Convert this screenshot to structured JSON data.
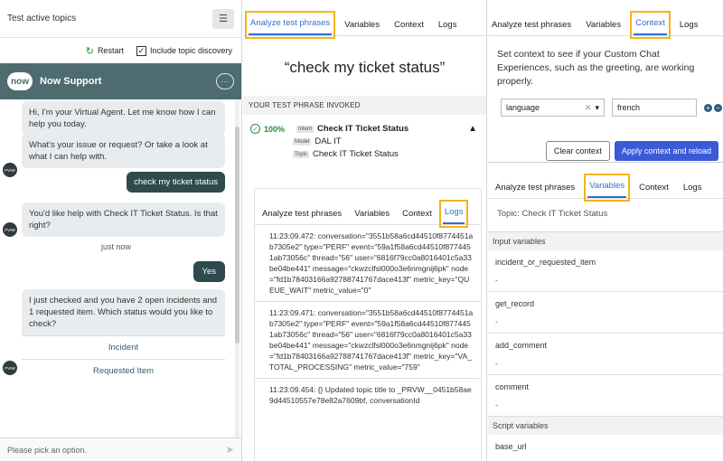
{
  "chat": {
    "panel_title": "Test active topics",
    "restart_label": "Restart",
    "include_discovery_label": "Include topic discovery",
    "header_name": "Now Support",
    "logo_text": "now",
    "avatar_text": "PVIW",
    "messages": {
      "bot1": "Hi, I'm your Virtual Agent. Let me know how I can help you today.",
      "bot2": "What's your issue or request? Or take a look at what I can help with.",
      "user1": "check my ticket status",
      "bot3": "You'd like help with Check IT Ticket Status. Is that right?",
      "timestamp": "just now",
      "user2": "Yes",
      "bot4": "I just checked and you have 2 open incidents and 1 requested item.  Which status would you like to check?",
      "option1": "Incident",
      "option2": "Requested Item"
    },
    "input_placeholder": "Please pick an option."
  },
  "analyze": {
    "tabs": [
      "Analyze test phrases",
      "Variables",
      "Context",
      "Logs"
    ],
    "phrase": "“check my ticket status”",
    "section_label": "YOUR TEST PHRASE INVOKED",
    "result": {
      "percent": "100%",
      "intent_tag": "Intent",
      "intent": "Check IT Ticket Status",
      "model_tag": "Model",
      "model": "DAL IT",
      "topic_tag": "Topic",
      "topic": "Check IT Ticket Status"
    },
    "logs_tabs": [
      "Analyze test phrases",
      "Variables",
      "Context",
      "Logs"
    ],
    "logs": [
      "11:23:09.472: conversation=\"3551b58a6cd44510f8774451ab7305e2\" type=\"PERF\" event=\"59a1f58a6cd44510f8774451ab73056c\" thread=\"56\" user=\"6816f79cc0a8016401c5a33be04be441\" message=\"ckwzclfsl000o3e6nmgnij6pk\" node=\"fd1b78403166a92788741767dace413f\" metric_key=\"QUEUE_WAIT\" metric_value=\"0\"",
      "11:23:09.471: conversation=\"3551b58a6cd44510f8774451ab7305e2\" type=\"PERF\" event=\"59a1f58a6cd44510f8774451ab73056c\" thread=\"56\" user=\"6816f79cc0a8016401c5a33be04be441\" message=\"ckwzclfsl000o3e6nmgnij6pk\" node=\"fd1b78403166a92788741767dace413f\" metric_key=\"VA_TOTAL_PROCESSING\" metric_value=\"759\"",
      "11:23:09.454: {} Updated topic title to _PRVW__0451b58ae9d44510557e78e82a7609bf, conversationId"
    ]
  },
  "context": {
    "tabs": [
      "Analyze test phrases",
      "Variables",
      "Context",
      "Logs"
    ],
    "description": "Set context to see if your Custom Chat Experiences, such as the greeting, are working properly.",
    "select_value": "language",
    "text_value": "french",
    "clear_label": "Clear context",
    "apply_label": "Apply context and reload"
  },
  "variables": {
    "tabs": [
      "Analyze test phrases",
      "Variables",
      "Context",
      "Logs"
    ],
    "topic_line": "Topic:  Check IT Ticket Status",
    "input_section": "Input variables",
    "inputs": [
      {
        "name": "incident_or_requested_item",
        "value": "-"
      },
      {
        "name": "get_record",
        "value": "-"
      },
      {
        "name": "add_comment",
        "value": "-"
      },
      {
        "name": "comment",
        "value": "-"
      }
    ],
    "script_section": "Script variables",
    "scripts": [
      {
        "name": "base_url",
        "value": ""
      }
    ]
  },
  "colors": {
    "accent_blue": "#2f6fd6",
    "highlight": "#f2b41c",
    "chat_header": "#4e6b70",
    "user_bubble": "#2f4a4e",
    "success": "#2b8a3e",
    "primary_button": "#3b5ad8"
  }
}
